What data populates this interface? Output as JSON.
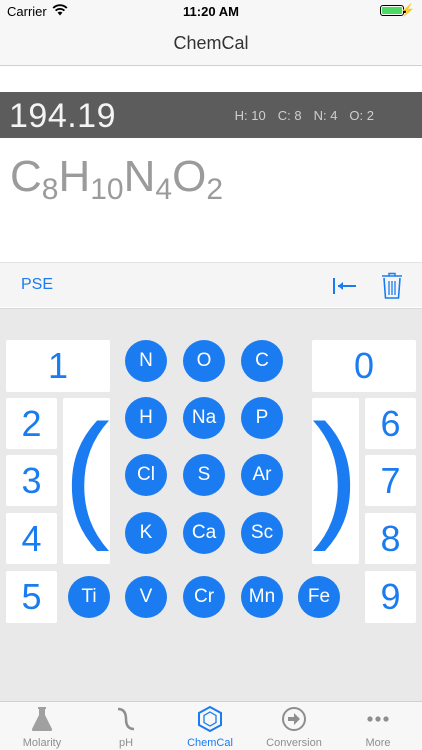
{
  "status": {
    "carrier": "Carrier",
    "time": "11:20 AM"
  },
  "nav": {
    "title": "ChemCal"
  },
  "result": {
    "mass": "194.19",
    "counts": [
      "H: 10",
      "C: 8",
      "N: 4",
      "O: 2"
    ]
  },
  "formula": [
    {
      "symbol": "C",
      "count": "8"
    },
    {
      "symbol": "H",
      "count": "10"
    },
    {
      "symbol": "N",
      "count": "4"
    },
    {
      "symbol": "O",
      "count": "2"
    }
  ],
  "toolbar": {
    "pse_label": "PSE"
  },
  "keypad": {
    "digits": [
      "0",
      "1",
      "2",
      "3",
      "4",
      "5",
      "6",
      "7",
      "8",
      "9"
    ],
    "open_paren": "(",
    "close_paren": ")",
    "elements": [
      "N",
      "O",
      "C",
      "H",
      "Na",
      "P",
      "Cl",
      "S",
      "Ar",
      "K",
      "Ca",
      "Sc",
      "Ti",
      "V",
      "Cr",
      "Mn",
      "Fe"
    ]
  },
  "tabs": [
    {
      "label": "Molarity",
      "icon": "flask-icon"
    },
    {
      "label": "pH",
      "icon": "titration-curve-icon"
    },
    {
      "label": "ChemCal",
      "icon": "hexagon-icon"
    },
    {
      "label": "Conversion",
      "icon": "arrow-circle-icon"
    },
    {
      "label": "More",
      "icon": "more-dots-icon"
    }
  ],
  "colors": {
    "accent": "#1a7cf0",
    "result_bar": "#5c5c5c",
    "formula_text": "#9b9b9b",
    "battery": "#4cd964"
  }
}
